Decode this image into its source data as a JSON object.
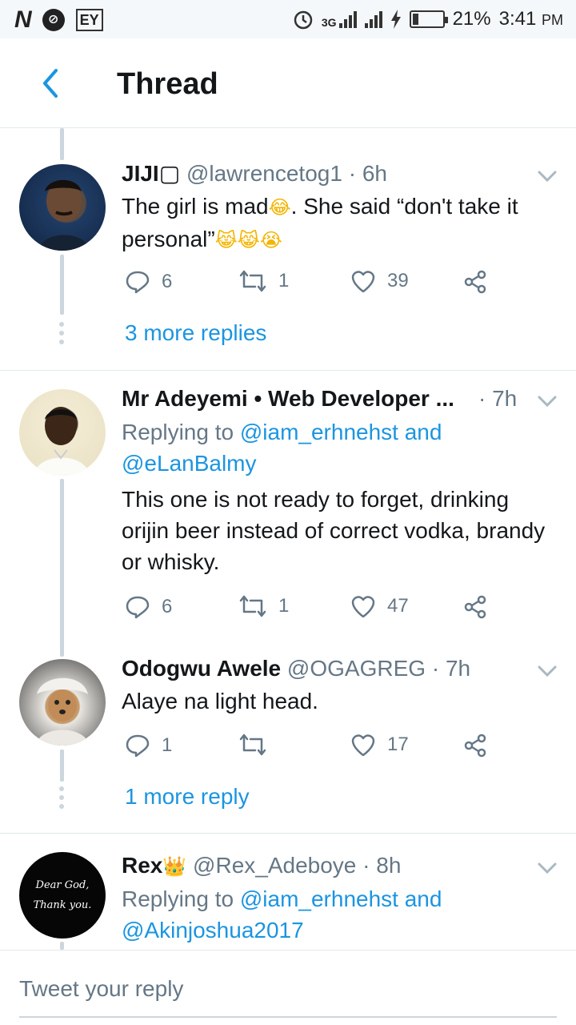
{
  "status_bar": {
    "left_n": "N",
    "left_circle": "⊘",
    "left_box": "EY",
    "network": "3G",
    "battery": "21%",
    "battery_level": 0.21,
    "time": "3:41",
    "ampm": "PM"
  },
  "header": {
    "title": "Thread"
  },
  "tweets": [
    {
      "name": "JIJI",
      "handle": "@lawrencetog1",
      "time": "6h",
      "text_line1": "The girl is mad",
      "text_line1_emoji": "😂",
      "text_line1_rest": ". She said “don't take it",
      "text_line2": "personal”",
      "text_line2_emoji": "😹😹😭",
      "replies": "6",
      "retweets": "1",
      "likes": "39",
      "more_replies": "3 more replies"
    },
    {
      "name": "Mr Adeyemi • Web Developer ...",
      "time": "· 7h",
      "replying_prefix": "Replying to",
      "replying_to_1": "@iam_erhnehst",
      "replying_and": "and",
      "replying_to_2": "@eLanBalmy",
      "text": "This one is not ready to forget, drinking orijin beer instead of correct vodka, brandy or whisky.",
      "replies": "6",
      "retweets": "1",
      "likes": "47"
    },
    {
      "name": "Odogwu Awele",
      "handle": "@OGAGREG",
      "time": "7h",
      "text": "Alaye na light head.",
      "replies": "1",
      "retweets": "",
      "likes": "17",
      "more_replies": "1 more reply"
    },
    {
      "name": "Rex",
      "name_emoji": "👑",
      "handle": "@Rex_Adeboye",
      "time": "8h",
      "replying_prefix": "Replying to",
      "replying_to_1": "@iam_erhnehst",
      "replying_and": "and",
      "replying_to_2": "@Akinjoshua2017",
      "avatar_text_1": "Dear God,",
      "avatar_text_2": "Thank you."
    }
  ],
  "reply_box": {
    "placeholder": "Tweet your reply"
  },
  "colors": {
    "accent": "#1b95e0",
    "muted": "#657786",
    "divider": "#e1e8ed"
  }
}
